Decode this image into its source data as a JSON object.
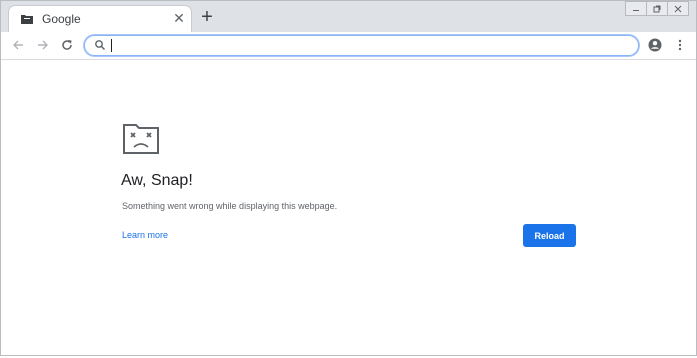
{
  "tab": {
    "title": "Google",
    "favicon": "folder-icon",
    "close_symbol": "✕"
  },
  "new_tab_symbol": "+",
  "window_controls": [
    "minimize-icon",
    "restore-icon",
    "close-icon"
  ],
  "toolbar": {
    "back": "back-arrow-icon",
    "forward": "forward-arrow-icon",
    "reload": "reload-icon",
    "account": "account-icon",
    "menu": "more-vert-icon"
  },
  "omnibox": {
    "value": "",
    "icon": "search-icon"
  },
  "error_page": {
    "icon": "sad-tab-icon",
    "title": "Aw, Snap!",
    "message": "Something went wrong while displaying this webpage.",
    "learn_more": "Learn more",
    "reload_label": "Reload"
  },
  "colors": {
    "accent": "#1a73e8",
    "tabstrip": "#dee1e6",
    "omnibox_focus": "#8ab4f8"
  }
}
